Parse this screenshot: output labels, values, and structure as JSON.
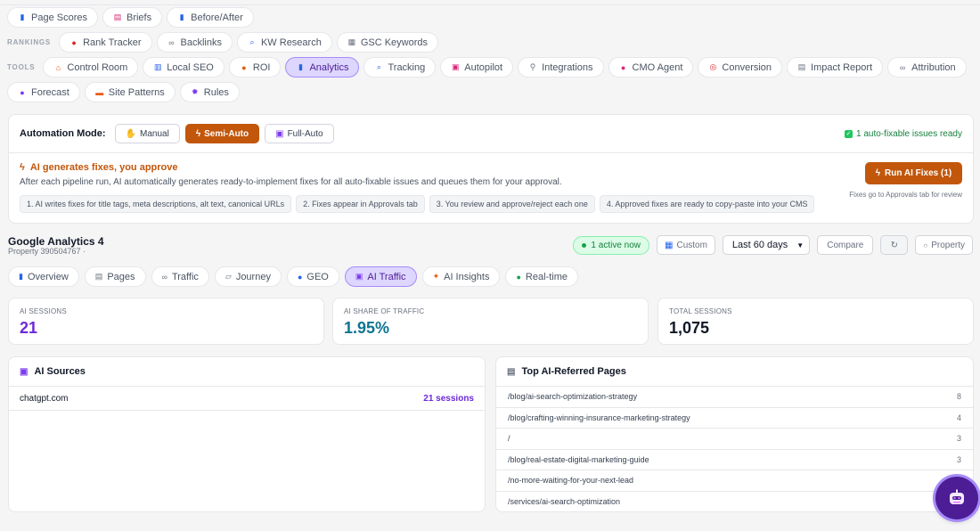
{
  "nav": {
    "row1": [
      {
        "label": "Page Scores",
        "icon": "bar-chart-icon"
      },
      {
        "label": "Briefs",
        "icon": "document-icon"
      },
      {
        "label": "Before/After",
        "icon": "bar-chart-icon"
      }
    ],
    "rankings_label": "RANKINGS",
    "rankings": [
      {
        "label": "Rank Tracker",
        "icon": "pin-icon"
      },
      {
        "label": "Backlinks",
        "icon": "link-icon"
      },
      {
        "label": "KW Research",
        "icon": "magnifier-icon"
      },
      {
        "label": "GSC Keywords",
        "icon": "chart-icon"
      }
    ],
    "tools_label": "TOOLS",
    "tools": [
      {
        "label": "Control Room",
        "icon": "home-icon"
      },
      {
        "label": "Local SEO",
        "icon": "building-icon"
      },
      {
        "label": "ROI",
        "icon": "money-bag-icon"
      },
      {
        "label": "Analytics",
        "icon": "bar-chart-icon",
        "active": true
      },
      {
        "label": "Tracking",
        "icon": "magnifier-icon"
      },
      {
        "label": "Autopilot",
        "icon": "robot-icon"
      },
      {
        "label": "Integrations",
        "icon": "plug-icon"
      },
      {
        "label": "CMO Agent",
        "icon": "brain-icon"
      },
      {
        "label": "Conversion",
        "icon": "target-icon"
      },
      {
        "label": "Impact Report",
        "icon": "report-icon"
      },
      {
        "label": "Attribution",
        "icon": "link-icon"
      }
    ],
    "row4": [
      {
        "label": "Forecast",
        "icon": "crystal-ball-icon"
      },
      {
        "label": "Site Patterns",
        "icon": "folder-icon"
      },
      {
        "label": "Rules",
        "icon": "gear-icon"
      }
    ]
  },
  "automation": {
    "label": "Automation Mode:",
    "modes": [
      {
        "label": "Manual",
        "icon": "hand-icon"
      },
      {
        "label": "Semi-Auto",
        "icon": "lightning-icon",
        "selected": true
      },
      {
        "label": "Full-Auto",
        "icon": "robot-icon"
      }
    ],
    "status": "1 auto-fixable issues ready",
    "heading": "AI generates fixes, you approve",
    "description": "After each pipeline run, AI automatically generates ready-to-implement fixes for all auto-fixable issues and queues them for your approval.",
    "steps": [
      "1. AI writes fixes for title tags, meta descriptions, alt text, canonical URLs",
      "2. Fixes appear in Approvals tab",
      "3. You review and approve/reject each one",
      "4. Approved fixes are ready to copy-paste into your CMS"
    ],
    "run_button": "Run AI Fixes (1)",
    "run_note": "Fixes go to Approvals tab for review"
  },
  "ga": {
    "title": "Google Analytics 4",
    "subtitle": "Property 390504767 ·",
    "active_now": "1 active now",
    "custom": "Custom",
    "range": "Last 60 days",
    "compare": "Compare",
    "refresh": "↻",
    "property": "Property"
  },
  "tabs": [
    {
      "label": "Overview",
      "icon": "bar-chart-icon"
    },
    {
      "label": "Pages",
      "icon": "document-icon"
    },
    {
      "label": "Traffic",
      "icon": "link-icon"
    },
    {
      "label": "Journey",
      "icon": "map-icon"
    },
    {
      "label": "GEO",
      "icon": "globe-icon"
    },
    {
      "label": "AI Traffic",
      "icon": "robot-icon",
      "active": true
    },
    {
      "label": "AI Insights",
      "icon": "sparkle-icon"
    },
    {
      "label": "Real-time",
      "icon": "green-dot-icon"
    }
  ],
  "stats": [
    {
      "label": "AI SESSIONS",
      "value": "21",
      "color": "#6d28d9"
    },
    {
      "label": "AI SHARE OF TRAFFIC",
      "value": "1.95%",
      "color": "#0e7490"
    },
    {
      "label": "TOTAL SESSIONS",
      "value": "1,075",
      "color": "#111827"
    }
  ],
  "sources": {
    "title": "AI Sources",
    "rows": [
      {
        "name": "chatgpt.com",
        "count": "21 sessions"
      }
    ]
  },
  "pages": {
    "title": "Top AI-Referred Pages",
    "rows": [
      {
        "path": "/blog/ai-search-optimization-strategy",
        "count": "8"
      },
      {
        "path": "/blog/crafting-winning-insurance-marketing-strategy",
        "count": "4"
      },
      {
        "path": "/",
        "count": "3"
      },
      {
        "path": "/blog/real-estate-digital-marketing-guide",
        "count": "3"
      },
      {
        "path": "/no-more-waiting-for-your-next-lead",
        "count": ""
      },
      {
        "path": "/services/ai-search-optimization",
        "count": ""
      }
    ]
  }
}
